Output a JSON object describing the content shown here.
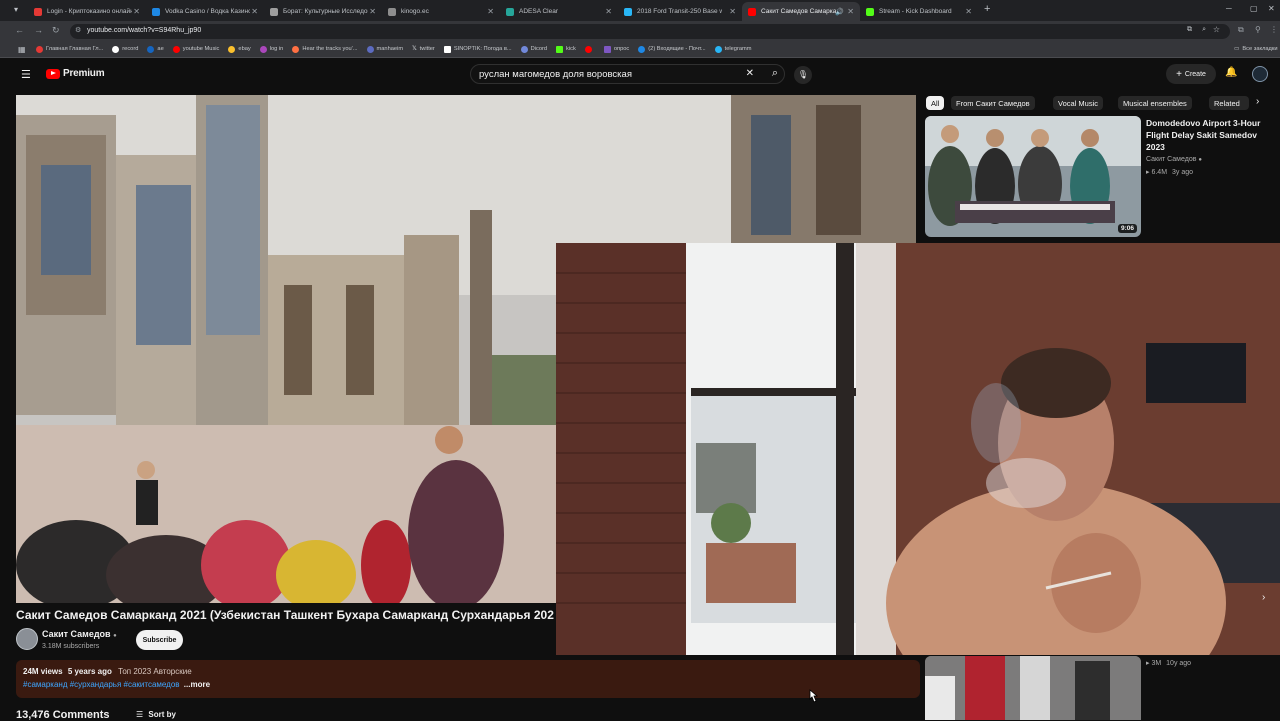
{
  "browser": {
    "tabs": [
      {
        "title": "Login - Криптоказино онлайн",
        "color": "#e53935"
      },
      {
        "title": "Vodka Casino / Водка Казино",
        "color": "#1e88e5"
      },
      {
        "title": "Борат: Культурные Исследова...",
        "color": "#9e9e9e"
      },
      {
        "title": "kinogo.ec",
        "color": "#8e8e8e"
      },
      {
        "title": "ADESA Clear",
        "color": "#26a69a"
      },
      {
        "title": "2018 Ford Transit-250 Base w/...",
        "color": "#29b6f6"
      },
      {
        "title": "Сакит Самедов Самарка...",
        "color": "#ff0000"
      },
      {
        "title": "Stream - Kick Dashboard",
        "color": "#53fc18"
      }
    ],
    "new_tab": "+",
    "url": "youtube.com/watch?v=S94Rhu_jp90",
    "bookmarks": [
      {
        "label": "Главная Главная Гл...",
        "color": "#e53935"
      },
      {
        "label": "record",
        "color": "#ffffff"
      },
      {
        "label": "ae",
        "color": "#1565c0"
      },
      {
        "label": "youtube Music",
        "color": "#ff0000"
      },
      {
        "label": "ebay",
        "color": "#fbc02d"
      },
      {
        "label": "log in",
        "color": "#ab47bc"
      },
      {
        "label": "Hear the tracks you'...",
        "color": "#ff7043"
      },
      {
        "label": "manhaeim",
        "color": "#5c6bc0"
      },
      {
        "label": "twitter",
        "color": "#ffffff"
      },
      {
        "label": "SINOPTIK: Погода в...",
        "color": "#ffffff"
      },
      {
        "label": "Dicord",
        "color": "#7289da"
      },
      {
        "label": "kick",
        "color": "#53fc18"
      },
      {
        "label": "",
        "color": "#ff0000"
      },
      {
        "label": "опрос",
        "color": "#7e57c2"
      },
      {
        "label": "(2) Входящие - Почт...",
        "color": "#1e88e5"
      },
      {
        "label": "telegramm",
        "color": "#29b6f6"
      }
    ],
    "other_bookmarks": "Все закладки"
  },
  "youtube": {
    "logo_text": "Premium",
    "search_query": "руслан магомедов доля воровская",
    "create_label": "Create",
    "chips": [
      "All",
      "From Сакит Самедов",
      "Vocal Music",
      "Musical ensembles",
      "Related"
    ],
    "recommendations": [
      {
        "title": "Domodedovo Airport 3-Hour Flight Delay Sakit Samedov 2023",
        "channel": "Сакит Самедов",
        "views": "6.4M",
        "age": "3y ago",
        "duration": "9:06"
      },
      {
        "views": "3M",
        "age": "10y ago"
      }
    ],
    "video": {
      "title": "Сакит Самедов Самарканд 2021 (Узбекистан Ташкент Бухара Самарканд Сурхандарья 202",
      "channel": "Сакит Самедов",
      "subscribers": "3.18M subscribers",
      "subscribe_label": "Subscribe",
      "views": "24M views",
      "age": "5 years ago",
      "category": "Топ 2023 Авторские",
      "hashtags": "#самарканд #сурхандарья #сакитсамедов",
      "more": "...more",
      "comments": "13,476 Comments",
      "sort_label": "Sort by"
    }
  }
}
